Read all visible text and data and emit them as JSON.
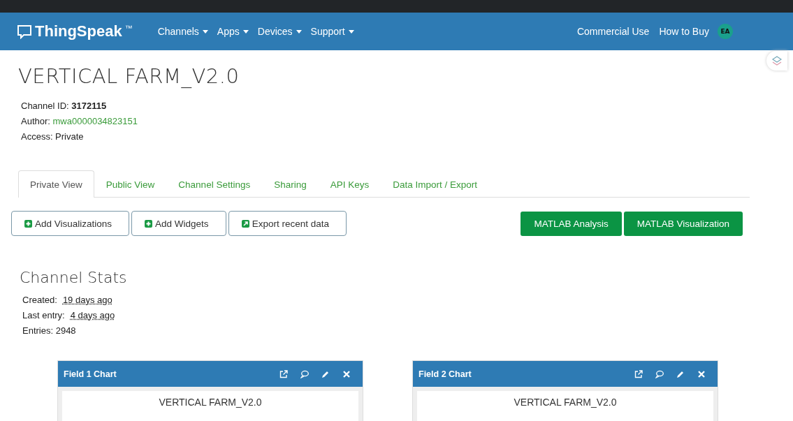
{
  "navbar": {
    "brand": "ThingSpeak",
    "trademark": "™",
    "menus": [
      {
        "label": "Channels"
      },
      {
        "label": "Apps"
      },
      {
        "label": "Devices"
      },
      {
        "label": "Support"
      }
    ],
    "links": [
      "Commercial Use",
      "How to Buy"
    ],
    "avatar": "EA"
  },
  "channel": {
    "title": "VERTICAL FARM_V2.0",
    "id_label": "Channel ID: ",
    "id": "3172115",
    "author_label": "Author: ",
    "author": "mwa0000034823151",
    "access": "Access: Private"
  },
  "tabs": [
    {
      "label": "Private View",
      "selected": true
    },
    {
      "label": "Public View",
      "selected": false
    },
    {
      "label": "Channel Settings",
      "selected": false
    },
    {
      "label": "Sharing",
      "selected": false
    },
    {
      "label": "API Keys",
      "selected": false
    },
    {
      "label": "Data Import / Export",
      "selected": false
    }
  ],
  "actions": [
    {
      "kind": "add",
      "label": "Add Visualizations"
    },
    {
      "kind": "add",
      "label": "Add Widgets"
    },
    {
      "kind": "export",
      "label": "Export recent data"
    }
  ],
  "matlab_buttons": [
    "MATLAB Analysis",
    "MATLAB Visualization"
  ],
  "stats": {
    "title": "Channel Stats",
    "created_label": "Created:",
    "created": "19 days ago",
    "last_entry_label": "Last entry:",
    "last_entry": "4 days ago",
    "entries": "Entries: 2948"
  },
  "charts": [
    {
      "title": "Field 1 Chart",
      "chart_title": "VERTICAL FARM_V2.0"
    },
    {
      "title": "Field 2 Chart",
      "chart_title": "VERTICAL FARM_V2.0"
    }
  ]
}
